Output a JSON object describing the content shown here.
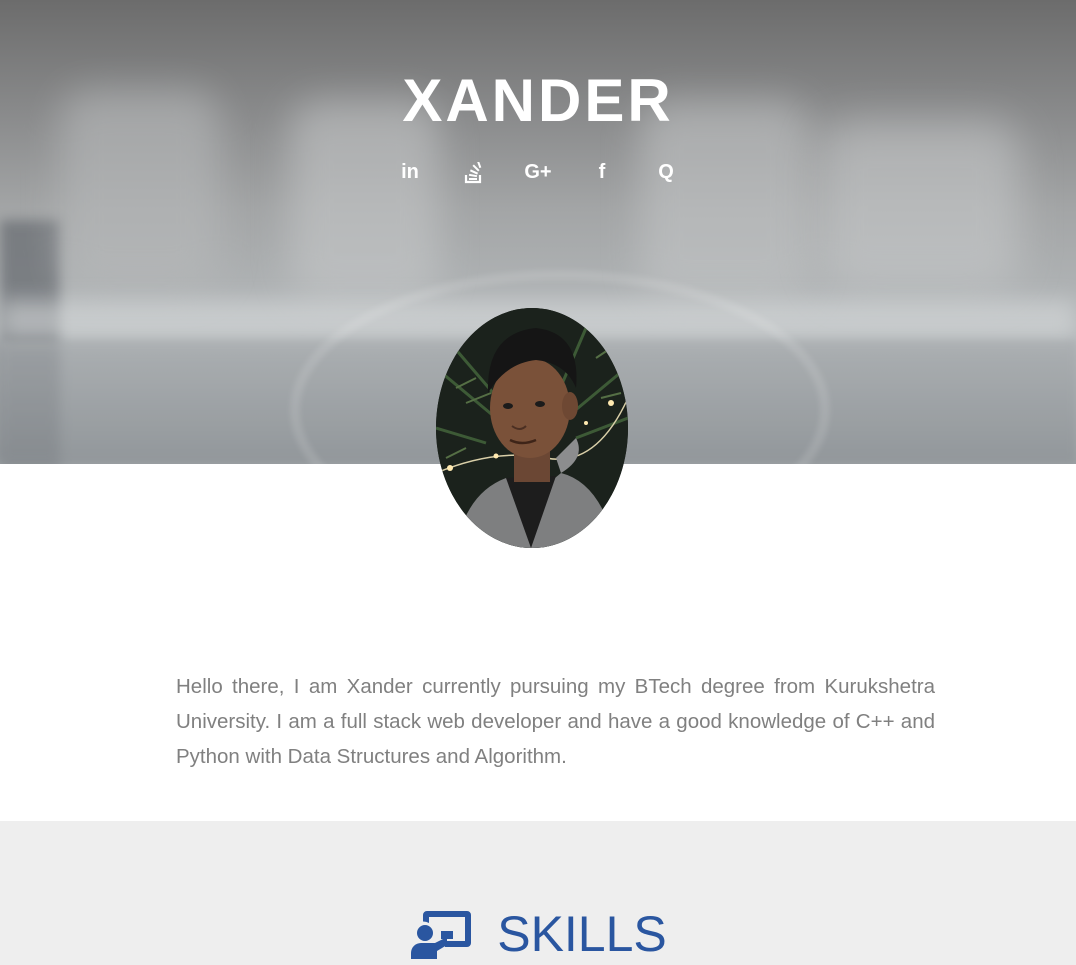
{
  "hero": {
    "name": "XANDER",
    "social": [
      {
        "label": "in",
        "icon": "linkedin-icon"
      },
      {
        "label": "",
        "icon": "stackoverflow-icon"
      },
      {
        "label": "G+",
        "icon": "google-plus-icon"
      },
      {
        "label": "f",
        "icon": "facebook-icon"
      },
      {
        "label": "Q",
        "icon": "quora-icon"
      }
    ]
  },
  "about": {
    "text": "Hello there, I am Xander currently pursuing my BTech degree from Kurukshetra University. I am a full stack web developer and have a good knowledge of C++ and Python with Data Structures and Algorithm."
  },
  "skills": {
    "title": "SKILLS",
    "icon": "teacher-board-icon"
  },
  "colors": {
    "accent": "#2a56a0",
    "text_muted": "#808080",
    "section_bg": "#eeeeee"
  }
}
